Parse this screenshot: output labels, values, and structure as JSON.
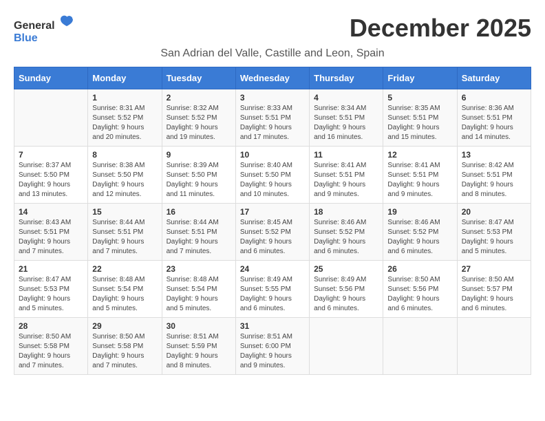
{
  "logo": {
    "general": "General",
    "blue": "Blue"
  },
  "title": "December 2025",
  "subtitle": "San Adrian del Valle, Castille and Leon, Spain",
  "weekdays": [
    "Sunday",
    "Monday",
    "Tuesday",
    "Wednesday",
    "Thursday",
    "Friday",
    "Saturday"
  ],
  "weeks": [
    [
      {
        "day": "",
        "info": ""
      },
      {
        "day": "1",
        "info": "Sunrise: 8:31 AM\nSunset: 5:52 PM\nDaylight: 9 hours\nand 20 minutes."
      },
      {
        "day": "2",
        "info": "Sunrise: 8:32 AM\nSunset: 5:52 PM\nDaylight: 9 hours\nand 19 minutes."
      },
      {
        "day": "3",
        "info": "Sunrise: 8:33 AM\nSunset: 5:51 PM\nDaylight: 9 hours\nand 17 minutes."
      },
      {
        "day": "4",
        "info": "Sunrise: 8:34 AM\nSunset: 5:51 PM\nDaylight: 9 hours\nand 16 minutes."
      },
      {
        "day": "5",
        "info": "Sunrise: 8:35 AM\nSunset: 5:51 PM\nDaylight: 9 hours\nand 15 minutes."
      },
      {
        "day": "6",
        "info": "Sunrise: 8:36 AM\nSunset: 5:51 PM\nDaylight: 9 hours\nand 14 minutes."
      }
    ],
    [
      {
        "day": "7",
        "info": "Sunrise: 8:37 AM\nSunset: 5:50 PM\nDaylight: 9 hours\nand 13 minutes."
      },
      {
        "day": "8",
        "info": "Sunrise: 8:38 AM\nSunset: 5:50 PM\nDaylight: 9 hours\nand 12 minutes."
      },
      {
        "day": "9",
        "info": "Sunrise: 8:39 AM\nSunset: 5:50 PM\nDaylight: 9 hours\nand 11 minutes."
      },
      {
        "day": "10",
        "info": "Sunrise: 8:40 AM\nSunset: 5:50 PM\nDaylight: 9 hours\nand 10 minutes."
      },
      {
        "day": "11",
        "info": "Sunrise: 8:41 AM\nSunset: 5:51 PM\nDaylight: 9 hours\nand 9 minutes."
      },
      {
        "day": "12",
        "info": "Sunrise: 8:41 AM\nSunset: 5:51 PM\nDaylight: 9 hours\nand 9 minutes."
      },
      {
        "day": "13",
        "info": "Sunrise: 8:42 AM\nSunset: 5:51 PM\nDaylight: 9 hours\nand 8 minutes."
      }
    ],
    [
      {
        "day": "14",
        "info": "Sunrise: 8:43 AM\nSunset: 5:51 PM\nDaylight: 9 hours\nand 7 minutes."
      },
      {
        "day": "15",
        "info": "Sunrise: 8:44 AM\nSunset: 5:51 PM\nDaylight: 9 hours\nand 7 minutes."
      },
      {
        "day": "16",
        "info": "Sunrise: 8:44 AM\nSunset: 5:51 PM\nDaylight: 9 hours\nand 7 minutes."
      },
      {
        "day": "17",
        "info": "Sunrise: 8:45 AM\nSunset: 5:52 PM\nDaylight: 9 hours\nand 6 minutes."
      },
      {
        "day": "18",
        "info": "Sunrise: 8:46 AM\nSunset: 5:52 PM\nDaylight: 9 hours\nand 6 minutes."
      },
      {
        "day": "19",
        "info": "Sunrise: 8:46 AM\nSunset: 5:52 PM\nDaylight: 9 hours\nand 6 minutes."
      },
      {
        "day": "20",
        "info": "Sunrise: 8:47 AM\nSunset: 5:53 PM\nDaylight: 9 hours\nand 5 minutes."
      }
    ],
    [
      {
        "day": "21",
        "info": "Sunrise: 8:47 AM\nSunset: 5:53 PM\nDaylight: 9 hours\nand 5 minutes."
      },
      {
        "day": "22",
        "info": "Sunrise: 8:48 AM\nSunset: 5:54 PM\nDaylight: 9 hours\nand 5 minutes."
      },
      {
        "day": "23",
        "info": "Sunrise: 8:48 AM\nSunset: 5:54 PM\nDaylight: 9 hours\nand 5 minutes."
      },
      {
        "day": "24",
        "info": "Sunrise: 8:49 AM\nSunset: 5:55 PM\nDaylight: 9 hours\nand 6 minutes."
      },
      {
        "day": "25",
        "info": "Sunrise: 8:49 AM\nSunset: 5:56 PM\nDaylight: 9 hours\nand 6 minutes."
      },
      {
        "day": "26",
        "info": "Sunrise: 8:50 AM\nSunset: 5:56 PM\nDaylight: 9 hours\nand 6 minutes."
      },
      {
        "day": "27",
        "info": "Sunrise: 8:50 AM\nSunset: 5:57 PM\nDaylight: 9 hours\nand 6 minutes."
      }
    ],
    [
      {
        "day": "28",
        "info": "Sunrise: 8:50 AM\nSunset: 5:58 PM\nDaylight: 9 hours\nand 7 minutes."
      },
      {
        "day": "29",
        "info": "Sunrise: 8:50 AM\nSunset: 5:58 PM\nDaylight: 9 hours\nand 7 minutes."
      },
      {
        "day": "30",
        "info": "Sunrise: 8:51 AM\nSunset: 5:59 PM\nDaylight: 9 hours\nand 8 minutes."
      },
      {
        "day": "31",
        "info": "Sunrise: 8:51 AM\nSunset: 6:00 PM\nDaylight: 9 hours\nand 9 minutes."
      },
      {
        "day": "",
        "info": ""
      },
      {
        "day": "",
        "info": ""
      },
      {
        "day": "",
        "info": ""
      }
    ]
  ]
}
